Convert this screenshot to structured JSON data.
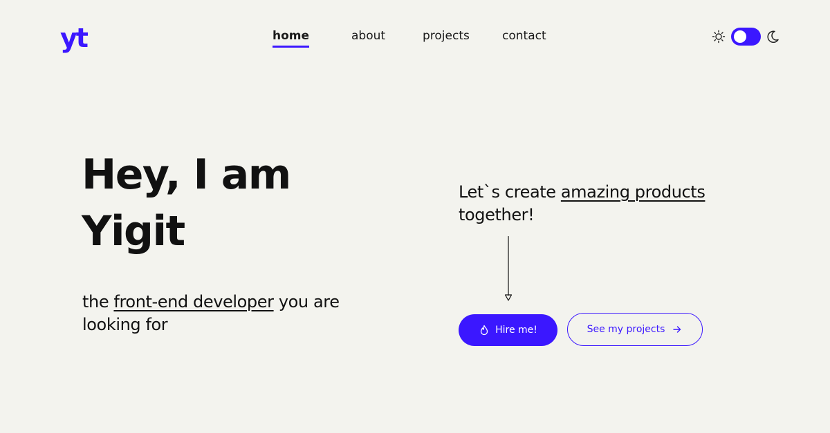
{
  "logo": {
    "text": "yt"
  },
  "nav": {
    "items": [
      {
        "label": "home",
        "active": true
      },
      {
        "label": "about",
        "active": false
      },
      {
        "label": "projects",
        "active": false
      },
      {
        "label": "contact",
        "active": false
      }
    ]
  },
  "theme": {
    "light_icon": "sun-icon",
    "dark_icon": "moon-icon",
    "toggle_state": "on"
  },
  "hero": {
    "title_line1": "Hey, I am",
    "title_line2": "Yigit",
    "subtitle_prefix": "the ",
    "subtitle_highlight": "front-end developer",
    "subtitle_suffix": " you are looking for"
  },
  "cta": {
    "tagline_prefix": "Let`s create ",
    "tagline_highlight": "amazing products",
    "tagline_suffix": "together!",
    "hire_label": "Hire me!",
    "hire_icon": "flame-icon",
    "projects_label": "See my projects",
    "projects_icon": "arrow-right-icon"
  },
  "colors": {
    "accent": "#3b17ff",
    "background": "#f3f3ee",
    "text": "#111111"
  }
}
